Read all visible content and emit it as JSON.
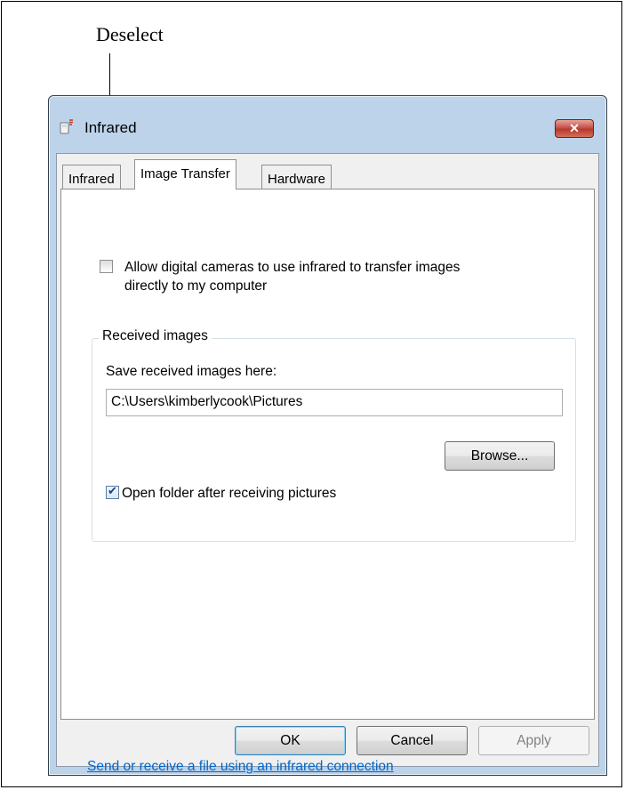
{
  "callout": {
    "text": "Deselect"
  },
  "window": {
    "title": "Infrared",
    "close_symbol": "✕"
  },
  "tabs": [
    {
      "label": "Infrared",
      "active": false
    },
    {
      "label": "Image Transfer",
      "active": true
    },
    {
      "label": "Hardware",
      "active": false
    }
  ],
  "allow_cameras": {
    "checked": false,
    "line1": "Allow digital cameras to use infrared to transfer images",
    "line2": "directly to my computer"
  },
  "received": {
    "legend": "Received images",
    "save_label": "Save received images here:",
    "path_value": "C:\\Users\\kimberlycook\\Pictures",
    "browse_label": "Browse...",
    "open_folder_label": "Open folder after receiving pictures",
    "open_folder_checked": true
  },
  "link_text": "Send or receive a file using an infrared connection",
  "buttons": {
    "ok": "OK",
    "cancel": "Cancel",
    "apply": "Apply"
  },
  "colors": {
    "link": "#0066cc",
    "close_red": "#c75050",
    "window_frame": "#bcd3ea"
  }
}
